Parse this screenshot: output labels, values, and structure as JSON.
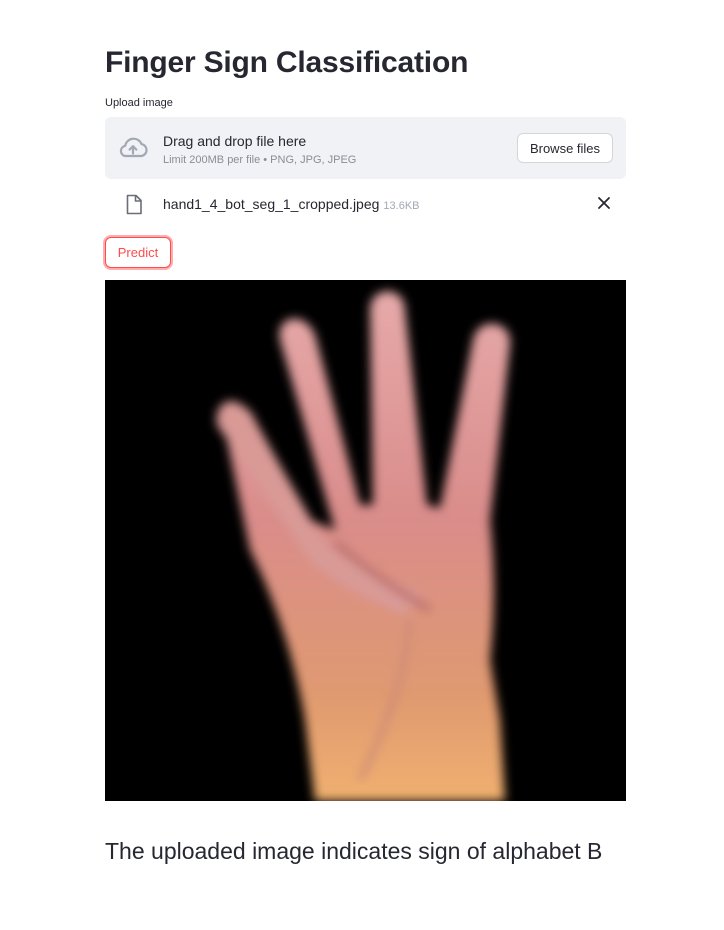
{
  "page": {
    "title": "Finger Sign Classification"
  },
  "uploader": {
    "label": "Upload image",
    "drop_title": "Drag and drop file here",
    "drop_limit": "Limit 200MB per file • PNG, JPG, JPEG",
    "browse_label": "Browse files",
    "upload_icon": "cloud-upload-icon"
  },
  "uploaded_file": {
    "name": "hand1_4_bot_seg_1_cropped.jpeg",
    "size": "13.6KB",
    "file_icon": "file-icon",
    "remove_icon": "close-icon"
  },
  "actions": {
    "predict_label": "Predict"
  },
  "image": {
    "description_icon": "hand-photo"
  },
  "result": {
    "text": "The uploaded image indicates sign of alphabet B"
  },
  "colors": {
    "accent": "#ff4b4b",
    "text": "#262730",
    "muted": "#8b8d96",
    "dropzone_bg": "#f0f2f6",
    "image_bg": "#000000"
  }
}
